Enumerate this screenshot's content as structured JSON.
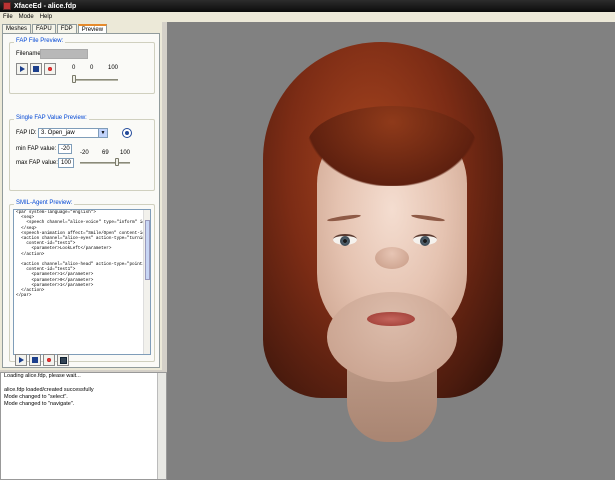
{
  "window": {
    "title": "XfaceEd - alice.fdp"
  },
  "menu": [
    "File",
    "Mode",
    "Help"
  ],
  "tabs": [
    {
      "label": "Meshes"
    },
    {
      "label": "FAPU"
    },
    {
      "label": "FDP"
    },
    {
      "label": "Preview",
      "active": true
    }
  ],
  "fap_file_preview": {
    "legend": "FAP File Preview:",
    "filename_label": "Filename:",
    "filename_value": "",
    "slider_labels": [
      "0",
      "0",
      "100"
    ],
    "slider_value": 0
  },
  "single_fap": {
    "legend": "Single FAP Value Preview:",
    "fap_id_label": "FAP ID:",
    "fap_id_value": "3. Open_jaw",
    "min_label": "min FAP value:",
    "min_value": "-20",
    "max_label": "max FAP value:",
    "max_value": "100",
    "slider_labels": [
      "-20",
      "69",
      "100"
    ],
    "slider_value": 69,
    "slider_min": -20,
    "slider_max": 100
  },
  "smil": {
    "legend": "SMIL-Agent Preview:",
    "code": [
      "<par system-language=\"english\">",
      "  <seq>",
      "    <speech channel=\"alice-voice\" type=\"inform\" id=\"test1\"",
      "  </seq>",
      "  <speech-animation affect=\"Smile/Open\" content-id=\"test",
      "  <action channel=\"alice-eyes\" action-type=\"turning\" inte",
      "    content-id=\"test1\">",
      "      <parameter>LookLeft</parameter>",
      "  </action>",
      "",
      "  <action channel=\"alice-head\" action-type=\"pointing\"",
      "    content-id=\"test1\">",
      "      <parameter>1</parameter>",
      "      <parameter>0</parameter>",
      "      <parameter>1</parameter>",
      "  </action>",
      "</par>"
    ]
  },
  "log": [
    "Loading alice.fdp, please wait...",
    "",
    "alice.fdp loaded/created successfully",
    "Mode changed to \"select\".",
    "Mode changed to \"navigate\"."
  ]
}
